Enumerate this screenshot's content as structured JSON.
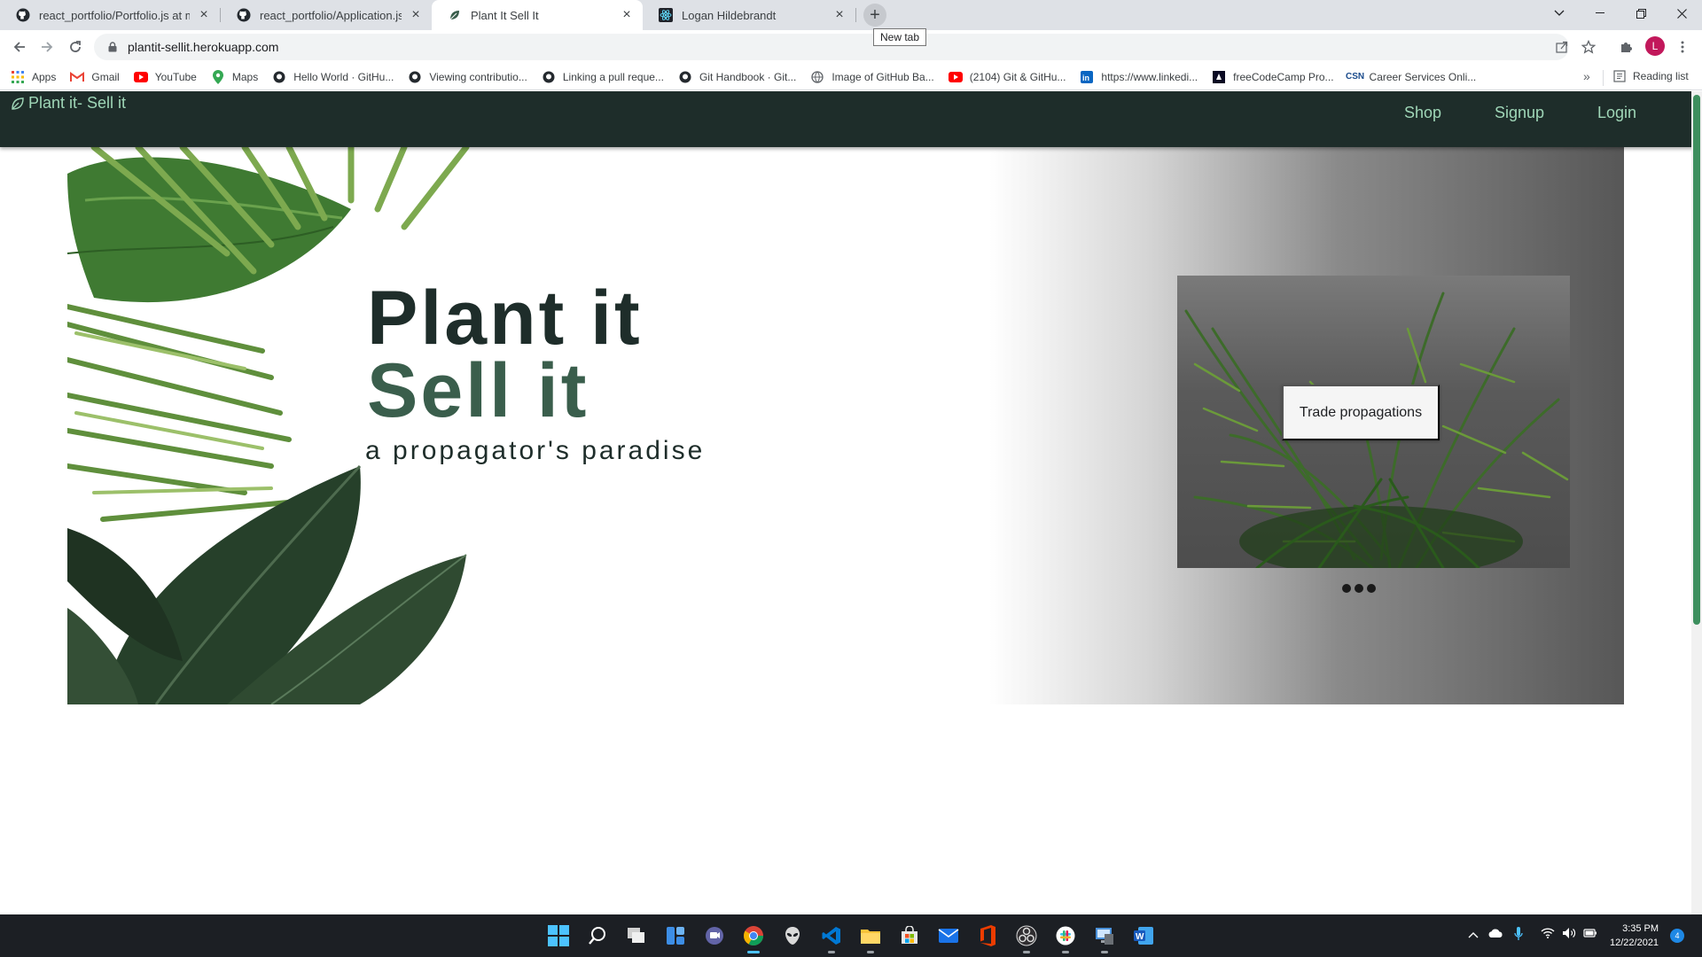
{
  "browser": {
    "tabs": [
      {
        "title": "react_portfolio/Portfolio.js at ma",
        "icon": "github-icon",
        "active": false
      },
      {
        "title": "react_portfolio/Application.js at m",
        "icon": "github-icon",
        "active": false
      },
      {
        "title": "Plant It Sell It",
        "icon": "leaf-icon",
        "active": true
      },
      {
        "title": "Logan Hildebrandt",
        "icon": "react-icon",
        "active": false
      }
    ],
    "new_tab_tooltip": "New tab",
    "url": "plantit-sellit.herokuapp.com",
    "profile_initial": "L",
    "bookmarks": [
      {
        "label": "Apps",
        "icon": "apps-grid-icon"
      },
      {
        "label": "Gmail",
        "icon": "gmail-icon"
      },
      {
        "label": "YouTube",
        "icon": "youtube-icon"
      },
      {
        "label": "Maps",
        "icon": "maps-pin-icon"
      },
      {
        "label": "Hello World · GitHu...",
        "icon": "github-icon"
      },
      {
        "label": "Viewing contributio...",
        "icon": "github-icon"
      },
      {
        "label": "Linking a pull reque...",
        "icon": "github-icon"
      },
      {
        "label": "Git Handbook · Git...",
        "icon": "github-icon"
      },
      {
        "label": "Image of GitHub Ba...",
        "icon": "globe-icon"
      },
      {
        "label": "(2104) Git & GitHu...",
        "icon": "youtube-icon"
      },
      {
        "label": "https://www.linkedi...",
        "icon": "linkedin-icon"
      },
      {
        "label": "freeCodeCamp Pro...",
        "icon": "freecodecamp-icon"
      },
      {
        "label": "Career Services Onli...",
        "icon": "csn-icon"
      }
    ],
    "reading_list": "Reading list"
  },
  "site": {
    "brand": "Plant it- Sell it",
    "nav": [
      "Shop",
      "Signup",
      "Login"
    ],
    "hero": {
      "title_line1": "Plant it",
      "title_line2": "Sell it",
      "tagline": "a propagator's paradise"
    },
    "carousel": {
      "button_label": "Trade propagations",
      "slide_count": 3
    }
  },
  "taskbar": {
    "time": "3:35 PM",
    "date": "12/22/2021",
    "notification_count": "4"
  },
  "colors": {
    "nav_bg": "#1e2d2a",
    "nav_text": "#9fd6b7",
    "title_dark": "#1e2d2a",
    "title_green": "#3a5e4c"
  }
}
